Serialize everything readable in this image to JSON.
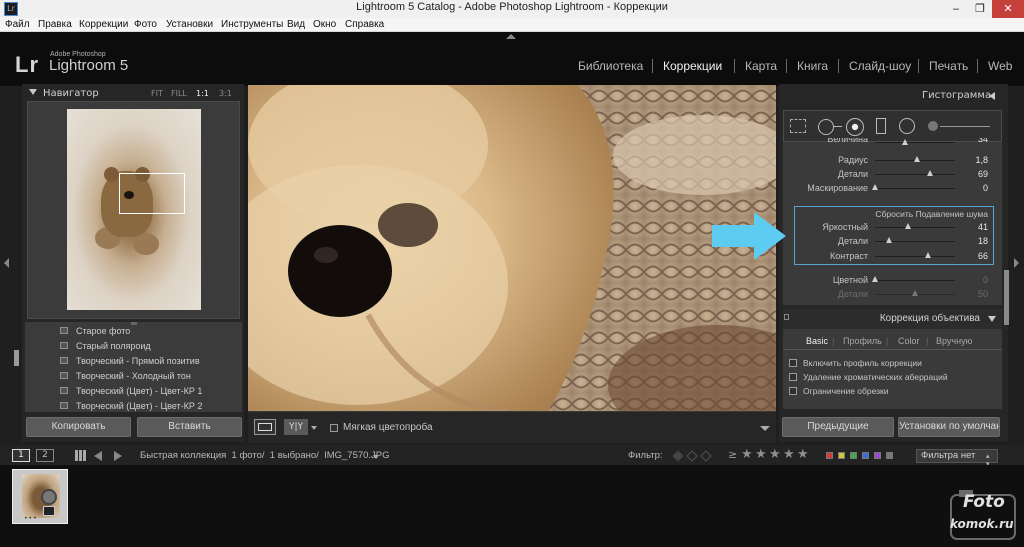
{
  "window": {
    "title": "Lightroom 5 Catalog - Adobe Photoshop Lightroom - Коррекции",
    "app_icon": "Lr",
    "minimize_glyph": "‒",
    "maximize_glyph": "❐",
    "close_glyph": "✕"
  },
  "menu": {
    "items": [
      "Файл",
      "Правка",
      "Коррекции",
      "Фото",
      "Установки",
      "Инструменты",
      "Вид",
      "Окно",
      "Справка"
    ]
  },
  "identity": {
    "lr": "Lr",
    "adobe": "Adobe Photoshop",
    "product": "Lightroom 5"
  },
  "modules": {
    "items": [
      "Библиотека",
      "Коррекции",
      "Карта",
      "Книга",
      "Слайд-шоу",
      "Печать",
      "Web"
    ],
    "active": "Коррекции"
  },
  "navigator": {
    "title": "Навигатор",
    "zoom_fit": "FIT",
    "zoom_fill": "FILL",
    "zoom_1_1": "1:1",
    "zoom_3_1": "3:1"
  },
  "presets": {
    "items": [
      "Старое фото",
      "Старый поляроид",
      "Творческий - Прямой позитив",
      "Творческий - Холодный тон",
      "Творческий (Цвет) - Цвет-КР 1",
      "Творческий (Цвет) - Цвет-КР 2"
    ]
  },
  "left_buttons": {
    "copy": "Копировать",
    "paste": "Вставить"
  },
  "toolbar": {
    "before_after": "Y|Y",
    "soft_proofing": "Мягкая цветопроба"
  },
  "histogram": {
    "title": "Гистограмма"
  },
  "sharpening": {
    "amount_label": "Величина",
    "amount_value": "34",
    "radius_label": "Радиус",
    "radius_value": "1,8",
    "detail_label": "Детали",
    "detail_value": "69",
    "masking_label": "Маскирование",
    "masking_value": "0"
  },
  "noise": {
    "reset_label": "Сбросить Подавление шума",
    "luminance_label": "Яркостный",
    "luminance_value": "41",
    "detail_label": "Детали",
    "detail_value": "18",
    "contrast_label": "Контраст",
    "contrast_value": "66",
    "color_label": "Цветной",
    "color_value": "0",
    "color_detail_label": "Детали",
    "color_detail_value": "50"
  },
  "sliders": {
    "amount": 0.38,
    "radius": 0.53,
    "detail": 0.69,
    "masking": 0.0,
    "luminance": 0.41,
    "luminance_detail": 0.18,
    "luminance_contrast": 0.66,
    "color": 0.0,
    "color_detail": 0.5
  },
  "lens": {
    "title": "Коррекция объектива",
    "tabs": [
      "Basic",
      "Профиль",
      "Color",
      "Вручную"
    ],
    "checkboxes": [
      "Включить профиль коррекции",
      "Удаление хроматических аберраций",
      "Ограничение обрезки"
    ]
  },
  "right_buttons": {
    "previous": "Предыдущие",
    "reset": "Установки по умолчанию..."
  },
  "filmbar": {
    "page1": "1",
    "page2": "2",
    "collection_info": "Быстрая коллекция  1 фото/  1 выбрано/  IMG_7570.JPG",
    "filter_label": "Фильтр:",
    "stars_prefix": "≥",
    "filter_none": "Фильтра нет"
  },
  "filter_colors": [
    "#d03a3a",
    "#d7c43a",
    "#46a846",
    "#3a6dd0",
    "#9a4ad0",
    "#777777"
  ],
  "watermark": {
    "line1": "Foto",
    "line2": "komok.ru"
  }
}
